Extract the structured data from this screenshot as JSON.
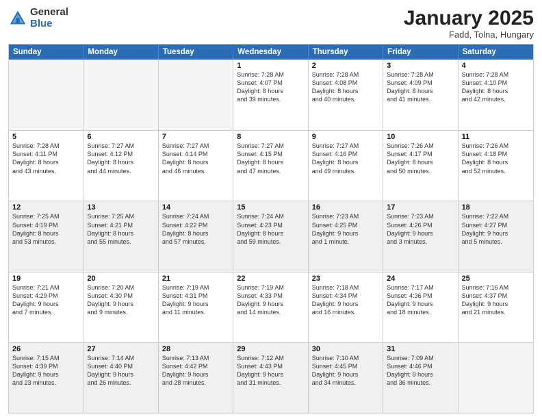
{
  "header": {
    "logo_general": "General",
    "logo_blue": "Blue",
    "month_title": "January 2025",
    "location": "Fadd, Tolna, Hungary"
  },
  "weekdays": [
    "Sunday",
    "Monday",
    "Tuesday",
    "Wednesday",
    "Thursday",
    "Friday",
    "Saturday"
  ],
  "rows": [
    [
      {
        "day": "",
        "info": "",
        "empty": true
      },
      {
        "day": "",
        "info": "",
        "empty": true
      },
      {
        "day": "",
        "info": "",
        "empty": true
      },
      {
        "day": "1",
        "info": "Sunrise: 7:28 AM\nSunset: 4:07 PM\nDaylight: 8 hours\nand 39 minutes."
      },
      {
        "day": "2",
        "info": "Sunrise: 7:28 AM\nSunset: 4:08 PM\nDaylight: 8 hours\nand 40 minutes."
      },
      {
        "day": "3",
        "info": "Sunrise: 7:28 AM\nSunset: 4:09 PM\nDaylight: 8 hours\nand 41 minutes."
      },
      {
        "day": "4",
        "info": "Sunrise: 7:28 AM\nSunset: 4:10 PM\nDaylight: 8 hours\nand 42 minutes."
      }
    ],
    [
      {
        "day": "5",
        "info": "Sunrise: 7:28 AM\nSunset: 4:11 PM\nDaylight: 8 hours\nand 43 minutes."
      },
      {
        "day": "6",
        "info": "Sunrise: 7:27 AM\nSunset: 4:12 PM\nDaylight: 8 hours\nand 44 minutes."
      },
      {
        "day": "7",
        "info": "Sunrise: 7:27 AM\nSunset: 4:14 PM\nDaylight: 8 hours\nand 46 minutes."
      },
      {
        "day": "8",
        "info": "Sunrise: 7:27 AM\nSunset: 4:15 PM\nDaylight: 8 hours\nand 47 minutes."
      },
      {
        "day": "9",
        "info": "Sunrise: 7:27 AM\nSunset: 4:16 PM\nDaylight: 8 hours\nand 49 minutes."
      },
      {
        "day": "10",
        "info": "Sunrise: 7:26 AM\nSunset: 4:17 PM\nDaylight: 8 hours\nand 50 minutes."
      },
      {
        "day": "11",
        "info": "Sunrise: 7:26 AM\nSunset: 4:18 PM\nDaylight: 8 hours\nand 52 minutes."
      }
    ],
    [
      {
        "day": "12",
        "info": "Sunrise: 7:25 AM\nSunset: 4:19 PM\nDaylight: 8 hours\nand 53 minutes.",
        "shaded": true
      },
      {
        "day": "13",
        "info": "Sunrise: 7:25 AM\nSunset: 4:21 PM\nDaylight: 8 hours\nand 55 minutes.",
        "shaded": true
      },
      {
        "day": "14",
        "info": "Sunrise: 7:24 AM\nSunset: 4:22 PM\nDaylight: 8 hours\nand 57 minutes.",
        "shaded": true
      },
      {
        "day": "15",
        "info": "Sunrise: 7:24 AM\nSunset: 4:23 PM\nDaylight: 8 hours\nand 59 minutes.",
        "shaded": true
      },
      {
        "day": "16",
        "info": "Sunrise: 7:23 AM\nSunset: 4:25 PM\nDaylight: 9 hours\nand 1 minute.",
        "shaded": true
      },
      {
        "day": "17",
        "info": "Sunrise: 7:23 AM\nSunset: 4:26 PM\nDaylight: 9 hours\nand 3 minutes.",
        "shaded": true
      },
      {
        "day": "18",
        "info": "Sunrise: 7:22 AM\nSunset: 4:27 PM\nDaylight: 9 hours\nand 5 minutes.",
        "shaded": true
      }
    ],
    [
      {
        "day": "19",
        "info": "Sunrise: 7:21 AM\nSunset: 4:29 PM\nDaylight: 9 hours\nand 7 minutes."
      },
      {
        "day": "20",
        "info": "Sunrise: 7:20 AM\nSunset: 4:30 PM\nDaylight: 9 hours\nand 9 minutes."
      },
      {
        "day": "21",
        "info": "Sunrise: 7:19 AM\nSunset: 4:31 PM\nDaylight: 9 hours\nand 11 minutes."
      },
      {
        "day": "22",
        "info": "Sunrise: 7:19 AM\nSunset: 4:33 PM\nDaylight: 9 hours\nand 14 minutes."
      },
      {
        "day": "23",
        "info": "Sunrise: 7:18 AM\nSunset: 4:34 PM\nDaylight: 9 hours\nand 16 minutes."
      },
      {
        "day": "24",
        "info": "Sunrise: 7:17 AM\nSunset: 4:36 PM\nDaylight: 9 hours\nand 18 minutes."
      },
      {
        "day": "25",
        "info": "Sunrise: 7:16 AM\nSunset: 4:37 PM\nDaylight: 9 hours\nand 21 minutes."
      }
    ],
    [
      {
        "day": "26",
        "info": "Sunrise: 7:15 AM\nSunset: 4:39 PM\nDaylight: 9 hours\nand 23 minutes.",
        "shaded": true
      },
      {
        "day": "27",
        "info": "Sunrise: 7:14 AM\nSunset: 4:40 PM\nDaylight: 9 hours\nand 26 minutes.",
        "shaded": true
      },
      {
        "day": "28",
        "info": "Sunrise: 7:13 AM\nSunset: 4:42 PM\nDaylight: 9 hours\nand 28 minutes.",
        "shaded": true
      },
      {
        "day": "29",
        "info": "Sunrise: 7:12 AM\nSunset: 4:43 PM\nDaylight: 9 hours\nand 31 minutes.",
        "shaded": true
      },
      {
        "day": "30",
        "info": "Sunrise: 7:10 AM\nSunset: 4:45 PM\nDaylight: 9 hours\nand 34 minutes.",
        "shaded": true
      },
      {
        "day": "31",
        "info": "Sunrise: 7:09 AM\nSunset: 4:46 PM\nDaylight: 9 hours\nand 36 minutes.",
        "shaded": true
      },
      {
        "day": "",
        "info": "",
        "empty": true,
        "shaded": true
      }
    ]
  ]
}
